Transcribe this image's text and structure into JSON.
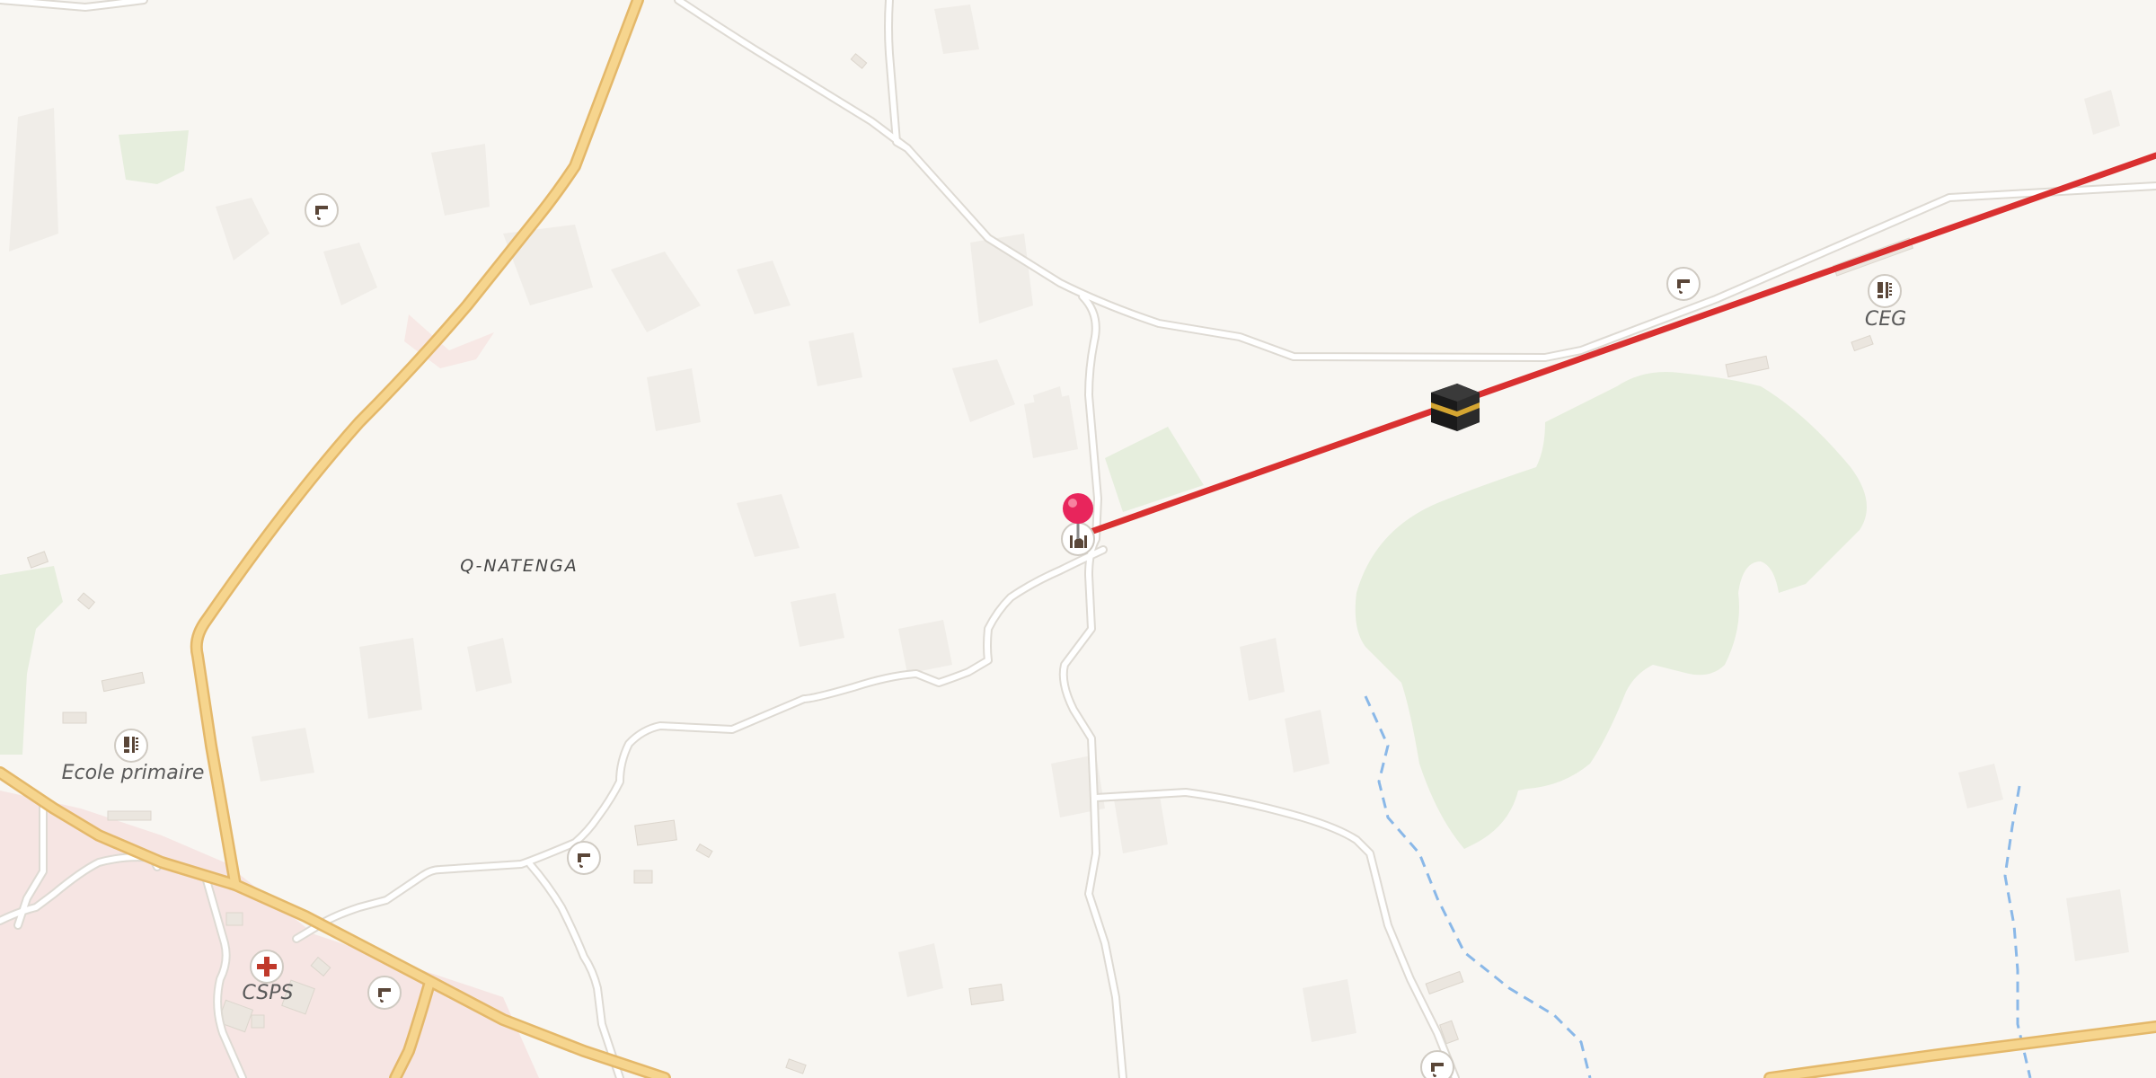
{
  "map": {
    "place_label": "Q-NATENGA",
    "poi_labels": {
      "school_west": "Ecole primaire",
      "school_east": "CEG",
      "clinic": "CSPS"
    },
    "icons": [
      "water-tap-icon",
      "school-icon",
      "clinic-icon",
      "mosque-icon",
      "kaaba-icon",
      "location-pin-icon"
    ],
    "colors": {
      "background": "#f8f6f2",
      "major_road": "#f6d58e",
      "major_road_casing": "#e4b86a",
      "minor_road": "#ffffff",
      "minor_road_casing": "#dedad3",
      "qibla_line": "#d93030",
      "pin": "#e8255c",
      "vegetation": "#e6eedd",
      "water": "#8ab8e8",
      "settlement": "#f6e2e0"
    }
  }
}
